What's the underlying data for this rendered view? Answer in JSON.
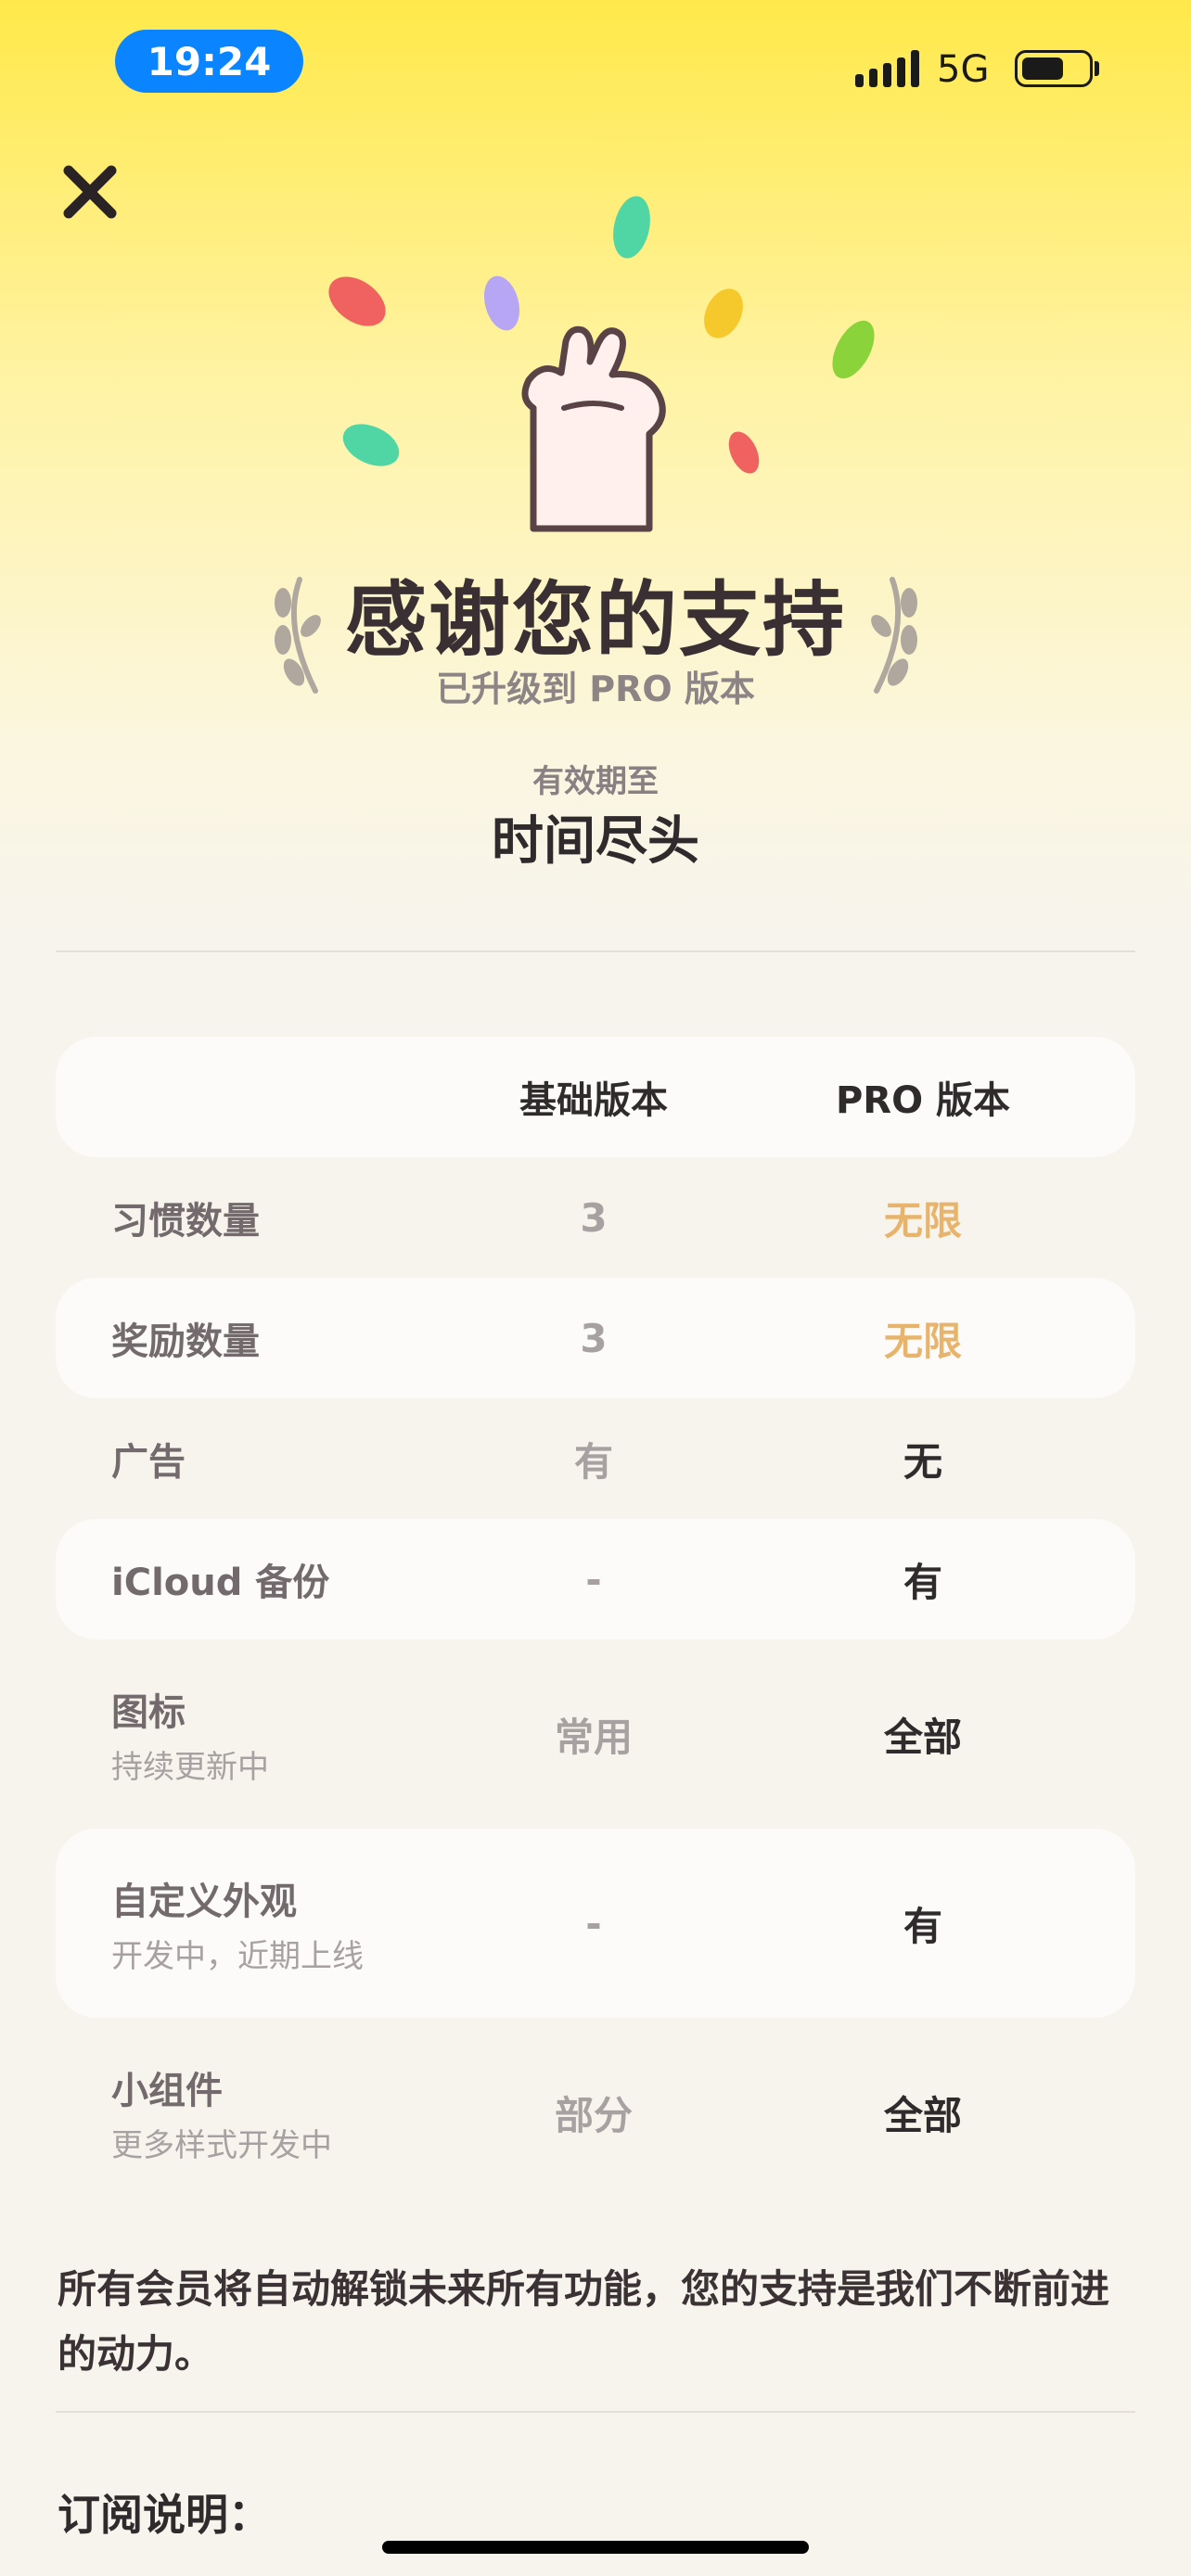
{
  "status_bar": {
    "time": "19:24",
    "network": "5G"
  },
  "header": {
    "title": "感谢您的支持",
    "subtitle": "已升级到 PRO 版本",
    "valid_label": "有效期至",
    "valid_value": "时间尽头"
  },
  "table": {
    "columns": [
      "基础版本",
      "PRO 版本"
    ],
    "rows": [
      {
        "label": "习惯数量",
        "sub": "",
        "basic": "3",
        "pro": "无限"
      },
      {
        "label": "奖励数量",
        "sub": "",
        "basic": "3",
        "pro": "无限"
      },
      {
        "label": "广告",
        "sub": "",
        "basic": "有",
        "pro": "无"
      },
      {
        "label": "iCloud 备份",
        "sub": "",
        "basic": "-",
        "pro": "有"
      },
      {
        "label": "图标",
        "sub": "持续更新中",
        "basic": "常用",
        "pro": "全部"
      },
      {
        "label": "自定义外观",
        "sub": "开发中，近期上线",
        "basic": "-",
        "pro": "有"
      },
      {
        "label": "小组件",
        "sub": "更多样式开发中",
        "basic": "部分",
        "pro": "全部"
      }
    ]
  },
  "footer_note": "所有会员将自动解锁未来所有功能，您的支持是我们不断前进的动力。",
  "subscription_title": "订阅说明：",
  "colors": {
    "accent_gold": "#e8b36a",
    "status_blue": "#0a84ff",
    "top_yellow": "#ffe94a"
  },
  "icons": [
    "close-icon",
    "cellular-signal-icon",
    "battery-icon",
    "celebration-hand-icon",
    "laurel-left-icon",
    "laurel-right-icon"
  ]
}
